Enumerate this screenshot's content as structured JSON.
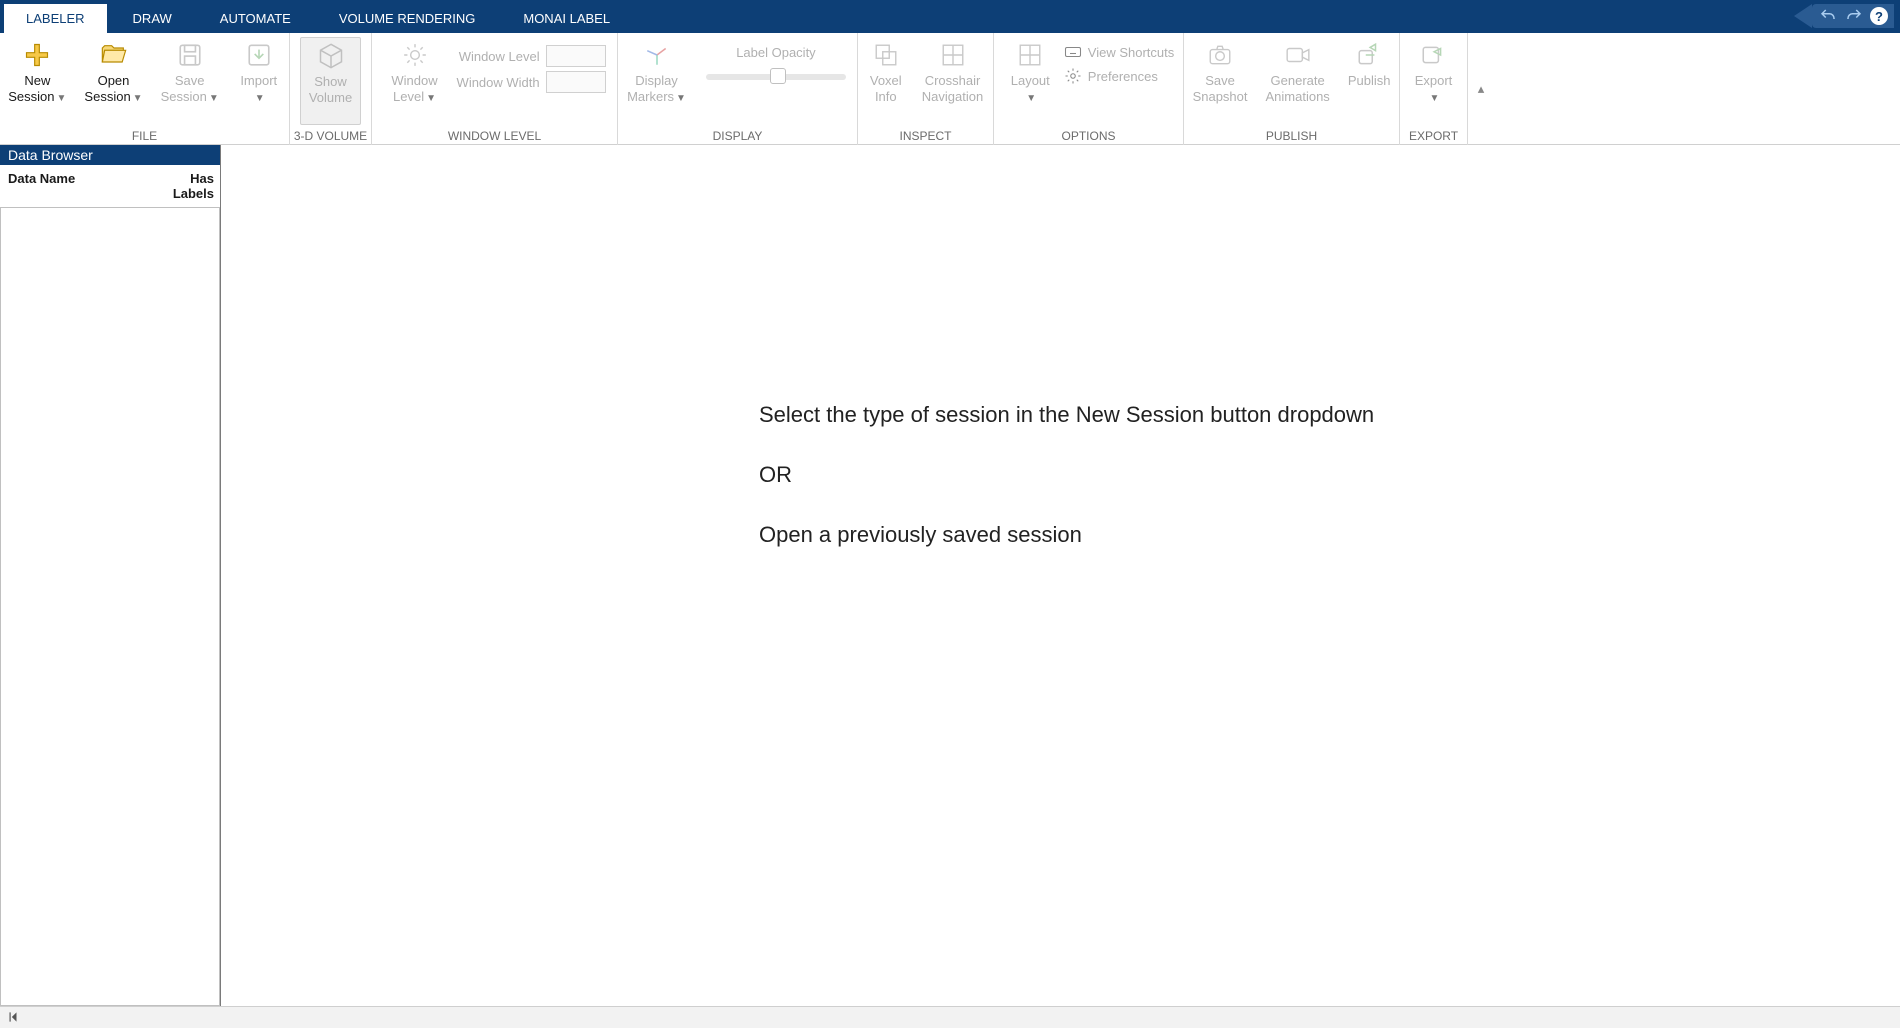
{
  "tabs": {
    "labeler": "LABELER",
    "draw": "DRAW",
    "automate": "AUTOMATE",
    "volume_rendering": "VOLUME RENDERING",
    "monai_label": "MONAI LABEL"
  },
  "ribbon": {
    "file": {
      "label": "FILE",
      "new_session": "New\nSession",
      "open_session": "Open\nSession",
      "save_session": "Save\nSession",
      "import": "Import"
    },
    "volume3d": {
      "label": "3-D VOLUME",
      "show_volume": "Show\nVolume"
    },
    "window_level": {
      "label": "WINDOW LEVEL",
      "window_level_btn": "Window\nLevel",
      "wl_label": "Window Level",
      "ww_label": "Window Width",
      "wl_value": "",
      "ww_value": ""
    },
    "display": {
      "label": "DISPLAY",
      "display_markers": "Display\nMarkers",
      "label_opacity": "Label Opacity"
    },
    "inspect": {
      "label": "INSPECT",
      "voxel_info": "Voxel\nInfo",
      "crosshair": "Crosshair\nNavigation"
    },
    "options": {
      "label": "OPTIONS",
      "layout": "Layout",
      "view_shortcuts": "View Shortcuts",
      "preferences": "Preferences"
    },
    "publish": {
      "label": "PUBLISH",
      "save_snapshot": "Save\nSnapshot",
      "generate_animations": "Generate\nAnimations",
      "publish": "Publish"
    },
    "export": {
      "label": "EXPORT",
      "export": "Export"
    }
  },
  "data_browser": {
    "title": "Data Browser",
    "col_name": "Data Name",
    "col_labels": "Has\nLabels"
  },
  "canvas": {
    "line1": "Select the type of session in the New Session button dropdown",
    "line2": "OR",
    "line3": "Open a previously saved session"
  },
  "qat": {
    "help": "?"
  }
}
